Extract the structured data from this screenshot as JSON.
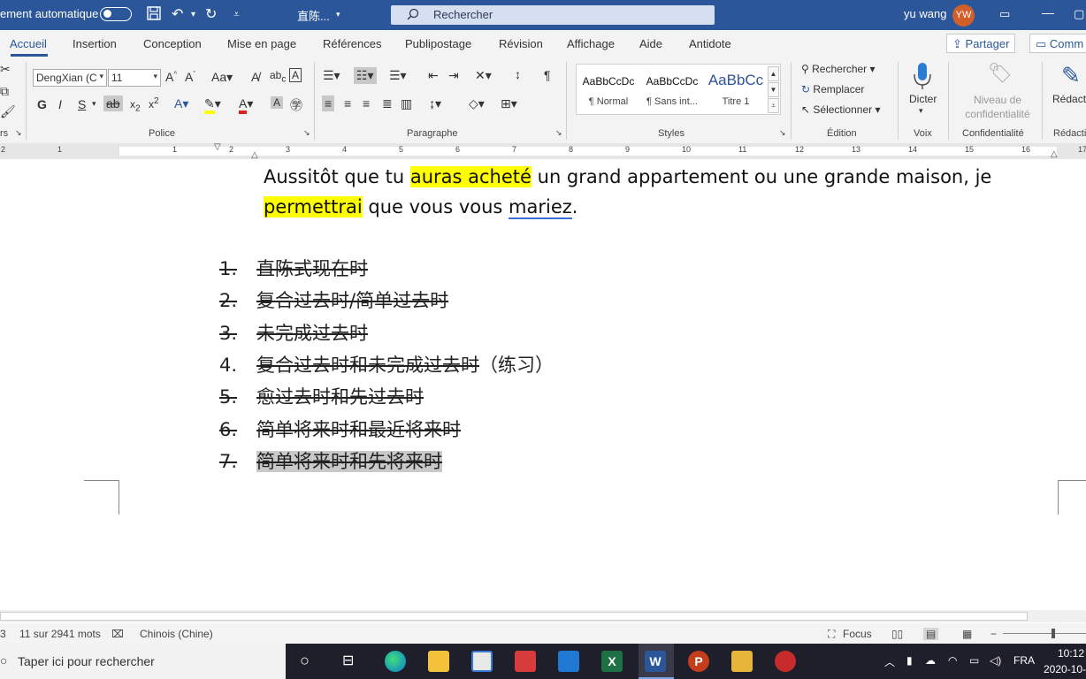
{
  "titlebar": {
    "autosave_label": "ement automatique",
    "doc_title": "直陈...",
    "search_placeholder": "Rechercher",
    "user_name": "yu wang",
    "user_initials": "YW"
  },
  "tabs": {
    "items": [
      "Accueil",
      "Insertion",
      "Conception",
      "Mise en page",
      "Références",
      "Publipostage",
      "Révision",
      "Affichage",
      "Aide",
      "Antidote"
    ],
    "share_label": "Partager",
    "comments_label": "Comm"
  },
  "ribbon": {
    "clipboard_label": "rs",
    "font_name": "DengXian (C",
    "font_size": "11",
    "police_label": "Police",
    "paragraphe_label": "Paragraphe",
    "styles": [
      {
        "preview": "AaBbCcDc",
        "name": "¶ Normal"
      },
      {
        "preview": "AaBbCcDc",
        "name": "¶ Sans int..."
      },
      {
        "preview": "AaBbCc",
        "name": "Titre 1"
      }
    ],
    "styles_label": "Styles",
    "find_label": "Rechercher",
    "replace_label": "Remplacer",
    "select_label": "Sélectionner",
    "edition_label": "Édition",
    "dictate_label": "Dicter",
    "voix_label": "Voix",
    "confidentiality_button": "Niveau de confidentialité",
    "confidentialite_label": "Confidentialité",
    "redaction_button": "Rédact",
    "redaction_label": "Rédacti"
  },
  "ruler": {
    "numbers": [
      "2",
      "1",
      "1",
      "2",
      "3",
      "4",
      "5",
      "6",
      "7",
      "8",
      "9",
      "10",
      "11",
      "12",
      "13",
      "14",
      "15",
      "16",
      "17"
    ]
  },
  "document": {
    "sentence_parts": [
      "Aussitôt que tu ",
      "auras acheté",
      " un grand appartement ou une grande maison, je"
    ],
    "sentence_line2_parts": [
      "permettrai",
      " que vous vous ",
      "mariez",
      "."
    ],
    "list": [
      {
        "num": "1.",
        "text": "直陈式现在时",
        "struck_num": true,
        "struck_text": true
      },
      {
        "num": "2.",
        "text": "复合过去时/简单过去时",
        "struck_num": true,
        "struck_text": true
      },
      {
        "num": "3.",
        "text": "未完成过去时",
        "struck_num": true,
        "struck_text": true
      },
      {
        "num": "4.",
        "text": "复合过去时和未完成过去时",
        "suffix": "（练习）",
        "struck_num": false,
        "struck_text": true
      },
      {
        "num": "5.",
        "text": "愈过去时和先过去时",
        "struck_num": true,
        "struck_text": true
      },
      {
        "num": "6.",
        "text": "简单将来时和最近将来时",
        "struck_num": true,
        "struck_text": true
      },
      {
        "num": "7.",
        "text": "简单将来时和先将来时",
        "struck_num": true,
        "struck_text": true,
        "selected": true
      }
    ]
  },
  "status": {
    "page_info": "3",
    "word_count": "11 sur 2941 mots",
    "language": "Chinois (Chine)",
    "focus_label": "Focus"
  },
  "taskbar": {
    "search_placeholder": "Taper ici pour rechercher",
    "language": "FRA",
    "time": "10:12",
    "date": "2020-10-"
  },
  "colors": {
    "word_blue": "#2b579a",
    "highlight": "#ffff00",
    "selection": "#c9c9c9"
  }
}
